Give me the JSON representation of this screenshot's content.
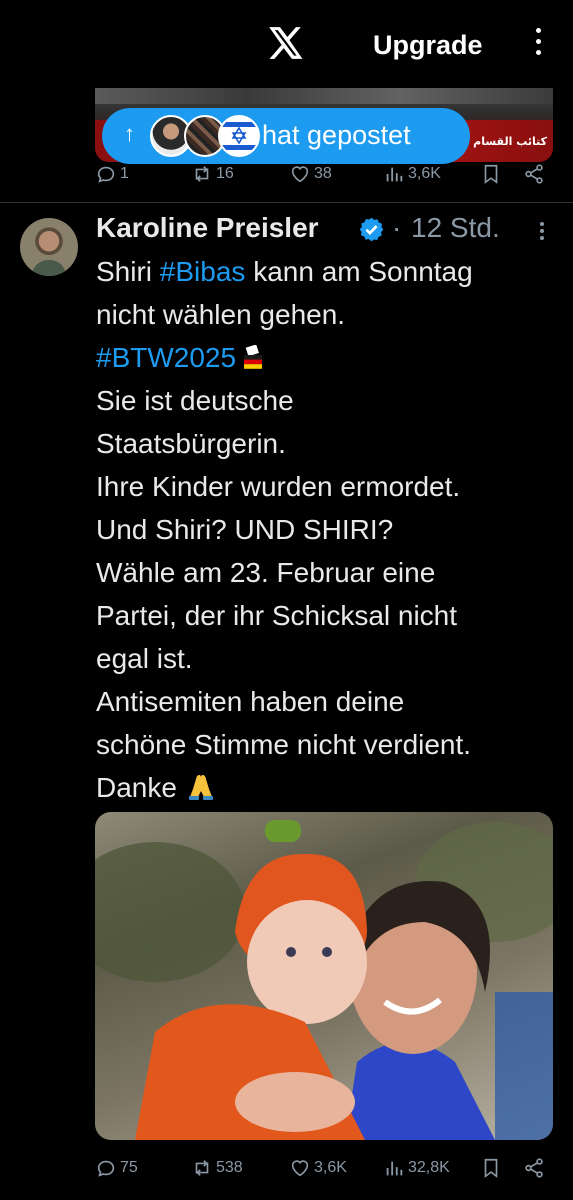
{
  "topbar": {
    "logo_icon": "x-logo-icon",
    "upgrade_label": "Upgrade",
    "menu_icon": "more-vertical-icon"
  },
  "previous_post": {
    "media_caption": "كتائب القسام للجزيرة",
    "reposted_pill": {
      "arrow": "↑",
      "label": "hat gepostet"
    },
    "actions": {
      "replies": "1",
      "reposts": "16",
      "likes": "38",
      "views": "3,6K"
    }
  },
  "tweet": {
    "author_name": "Karoline Preisler",
    "separator": "·",
    "timestamp": "12 Std.",
    "lines": [
      {
        "pre": "Shiri ",
        "hashtag": "#Bibas",
        "post": " kann am Sonntag"
      },
      {
        "text": "nicht wählen gehen."
      },
      {
        "hashtag": "#BTW2025",
        "emoji": "ballot-box-icon"
      },
      {
        "text": "Sie ist deutsche"
      },
      {
        "text": "Staatsbürgerin."
      },
      {
        "text": "Ihre Kinder wurden ermordet."
      },
      {
        "text": "Und Shiri? UND SHIRI?"
      },
      {
        "text": "Wähle am 23. Februar eine"
      },
      {
        "text": "Partei, der ihr Schicksal nicht"
      },
      {
        "text": "egal ist."
      },
      {
        "text": "Antisemiten haben deine"
      },
      {
        "text": "schöne Stimme nicht verdient."
      },
      {
        "text": "Danke",
        "emoji": "folded-hands-icon"
      }
    ],
    "actions": {
      "replies": "75",
      "reposts": "538",
      "likes": "3,6K",
      "views": "32,8K"
    }
  },
  "colors": {
    "background": "#000000",
    "text": "#e7e9ea",
    "muted": "#8b98a5",
    "accent": "#1d9bf0"
  }
}
